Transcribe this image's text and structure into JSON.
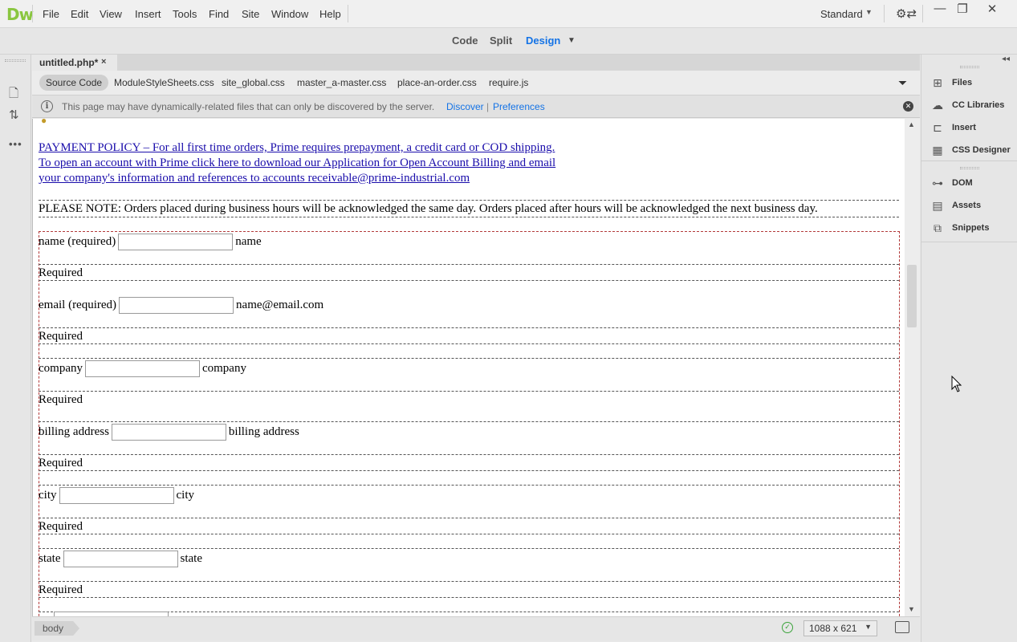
{
  "app": {
    "logo": "Dw",
    "workspace": "Standard"
  },
  "menu": [
    "File",
    "Edit",
    "View",
    "Insert",
    "Tools",
    "Find",
    "Site",
    "Window",
    "Help"
  ],
  "views": {
    "code": "Code",
    "split": "Split",
    "design": "Design"
  },
  "document": {
    "tab_title": "untitled.php*",
    "close_glyph": "×"
  },
  "related_files": [
    "Source Code",
    "ModuleStyleSheets.css",
    "site_global.css",
    "master_a-master.css",
    "place-an-order.css",
    "require.js"
  ],
  "infobar": {
    "message": "This page may have dynamically-related files that can only be discovered by the server.",
    "discover": "Discover",
    "separator": "|",
    "preferences": "Preferences"
  },
  "page": {
    "payment_links": [
      "PAYMENT POLICY – For all first time orders, Prime requires prepayment, a credit card or COD shipping.",
      "To open an account with Prime click here to download our Application for Open Account Billing and email",
      "your company's information and references to accounts receivable@prime-industrial.com"
    ],
    "note": "PLEASE NOTE: Orders placed during business hours will be acknowledged the same day. Orders placed after hours will be acknowledged the next business day.",
    "required_text": "Required",
    "fields": [
      {
        "label": "name (required)",
        "hint": "name"
      },
      {
        "label": "email (required)",
        "hint": "name@email.com"
      },
      {
        "label": "company",
        "hint": "company"
      },
      {
        "label": "billing address",
        "hint": "billing address"
      },
      {
        "label": "city",
        "hint": "city"
      },
      {
        "label": "state",
        "hint": "state"
      }
    ]
  },
  "status": {
    "tag": "body",
    "size": "1088 x 621"
  },
  "panels": [
    "Files",
    "CC Libraries",
    "Insert",
    "CSS Designer",
    "DOM",
    "Assets",
    "Snippets"
  ],
  "icons": {
    "new-file": "new-file-icon",
    "file-transfer": "file-transfer-icon",
    "more": "more-icon",
    "filter": "filter-icon",
    "info": "info-icon",
    "sync": "sync-settings-icon"
  }
}
